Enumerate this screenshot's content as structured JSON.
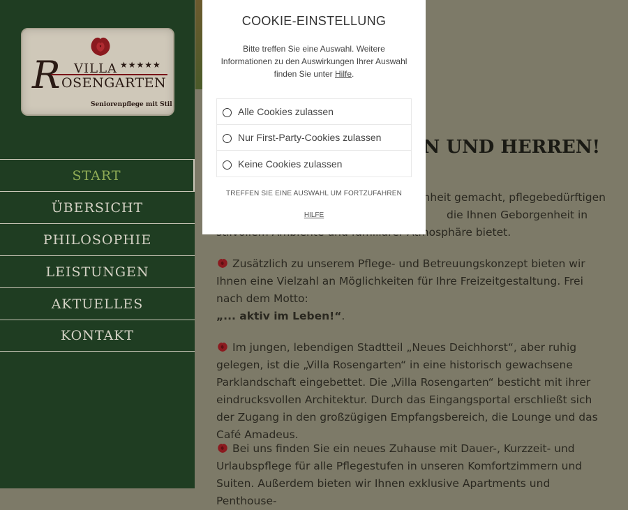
{
  "logo": {
    "villa": "VILLA",
    "stars": "★★★★★",
    "initial": "R",
    "name_rest": "OSENGARTEN",
    "tagline": "Seniorenpflege mit Stil"
  },
  "nav": {
    "items": [
      {
        "label": "START",
        "active": true
      },
      {
        "label": "ÜBERSICHT"
      },
      {
        "label": "PHILOSOPHIE"
      },
      {
        "label": "LEISTUNGEN"
      },
      {
        "label": "AKTUELLES"
      },
      {
        "label": "KONTAKT"
      }
    ]
  },
  "main": {
    "heading": "MEN UND HERREN!",
    "p1_line1": "enheit gemacht, pflegebedürftigen",
    "p1_line2": "die Ihnen Geborgenheit in",
    "p1_line3": "stilvollem Ambiente und familiärer Atmosphäre bietet.",
    "p2": "Zusätzlich zu unserem Pflege- und Betreuungskonzept bieten wir Ihnen eine Vielzahl an Möglichkeiten für Ihre Freizeitgestaltung. Frei nach dem Motto:",
    "p2_motto": "„... aktiv im Leben!“",
    "p2_dot": ".",
    "p3": "Im jungen, lebendigen Stadtteil „Neues Deichhorst“, aber ruhig gelegen, ist die „Villa Rosengarten“ in eine historisch gewachsene Parklandschaft eingebettet. Die „Villa Rosengarten“ besticht mit ihrer eindrucksvollen Architektur. Durch das Eingangsportal erschließt sich der Zugang in den großzügigen Empfangsbereich, die Lounge und das Café Amadeus.",
    "p4": "Bei uns finden Sie ein neues Zuhause mit Dauer-, Kurzzeit- und Urlaubspflege für alle Pflegestufen in unseren Komfortzimmern und Suiten. Außerdem bieten wir Ihnen exklusive Apartments und Penthouse-"
  },
  "cookie": {
    "title": "COOKIE-EINSTELLUNG",
    "desc": "Bitte treffen Sie eine Auswahl. Weitere Informationen zu den Auswirkungen Ihrer Auswahl finden Sie unter",
    "desc_link": "Hilfe",
    "desc_end": ".",
    "options": [
      {
        "label": "Alle Cookies zulassen"
      },
      {
        "label": "Nur First-Party-Cookies zulassen"
      },
      {
        "label": "Keine Cookies zulassen"
      }
    ],
    "hint": "TREFFEN SIE EINE AUSWAHL UM FORTZUFAHREN",
    "help": "HILFE"
  },
  "colors": {
    "sidebar_bg": "#1f3d22",
    "nav_active": "#8fab55",
    "rose_red": "#8b1a1f"
  }
}
